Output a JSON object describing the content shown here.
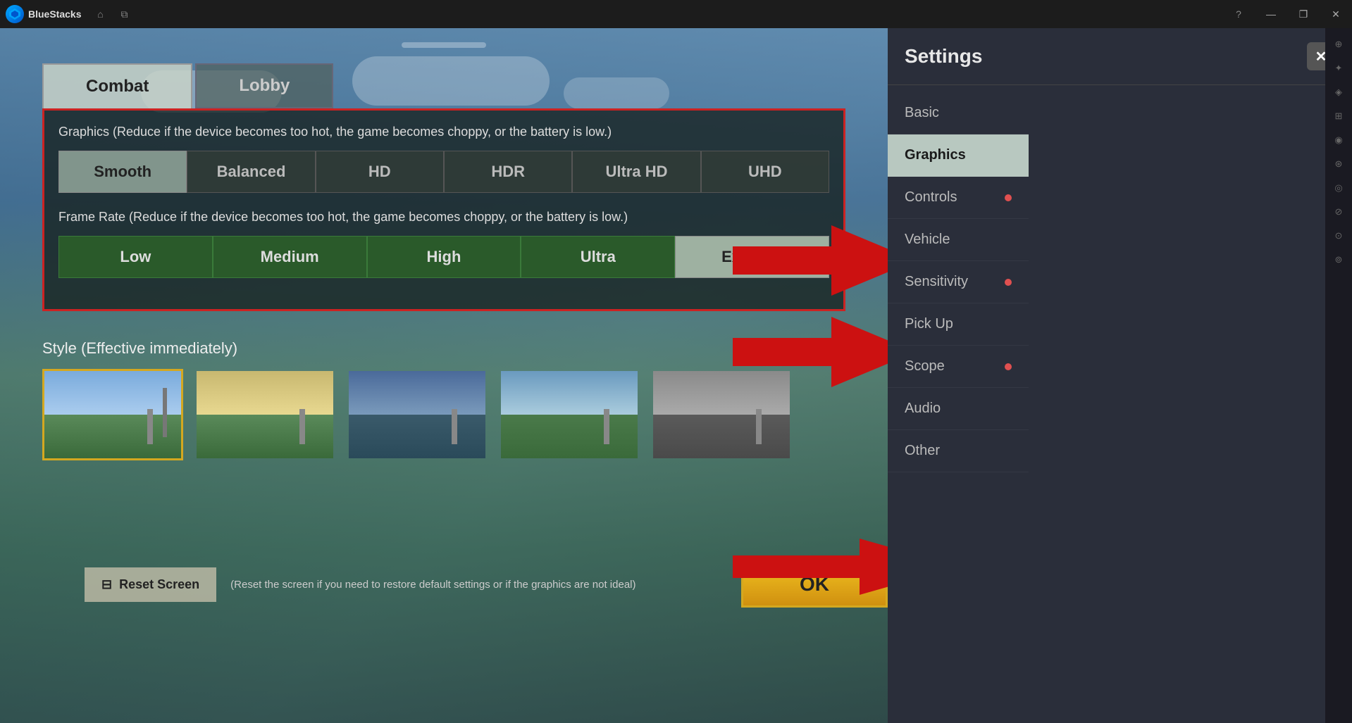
{
  "titlebar": {
    "app_name": "BlueStacks",
    "home_icon": "⌂",
    "multi_icon": "⧉",
    "help_icon": "?",
    "minimize": "—",
    "restore": "❐",
    "close": "✕"
  },
  "game": {
    "scroll_bar": true
  },
  "settings_panel": {
    "title": "Settings",
    "close_icon": "✕",
    "nav_items": [
      {
        "label": "Basic",
        "has_dot": false,
        "active": false
      },
      {
        "label": "Graphics",
        "has_dot": false,
        "active": true
      },
      {
        "label": "Controls",
        "has_dot": true,
        "active": false
      },
      {
        "label": "Vehicle",
        "has_dot": false,
        "active": false
      },
      {
        "label": "Sensitivity",
        "has_dot": true,
        "active": false
      },
      {
        "label": "Pick Up",
        "has_dot": false,
        "active": false
      },
      {
        "label": "Scope",
        "has_dot": true,
        "active": false
      },
      {
        "label": "Audio",
        "has_dot": false,
        "active": false
      },
      {
        "label": "Other",
        "has_dot": false,
        "active": false
      }
    ]
  },
  "tabs": [
    {
      "label": "Combat",
      "active": true
    },
    {
      "label": "Lobby",
      "active": false
    }
  ],
  "graphics_section": {
    "label": "Graphics (Reduce if the device becomes too hot, the game becomes choppy, or the battery is low.)",
    "options": [
      {
        "label": "Smooth",
        "selected": true
      },
      {
        "label": "Balanced",
        "selected": false
      },
      {
        "label": "HD",
        "selected": false
      },
      {
        "label": "HDR",
        "selected": false
      },
      {
        "label": "Ultra HD",
        "selected": false
      },
      {
        "label": "UHD",
        "selected": false
      }
    ]
  },
  "framerate_section": {
    "label": "Frame Rate (Reduce if the device becomes too hot, the game becomes choppy, or the battery is low.)",
    "options": [
      {
        "label": "Low",
        "selected": false
      },
      {
        "label": "Medium",
        "selected": false
      },
      {
        "label": "High",
        "selected": false
      },
      {
        "label": "Ultra",
        "selected": false
      },
      {
        "label": "Extreme",
        "selected": true
      }
    ]
  },
  "style_section": {
    "label": "Style (Effective immediately)",
    "thumbnails": [
      {
        "selected": true
      },
      {
        "selected": false
      },
      {
        "selected": false
      },
      {
        "selected": false
      },
      {
        "selected": false
      }
    ]
  },
  "bottom_bar": {
    "reset_icon": "⊟",
    "reset_label": "Reset Screen",
    "reset_note": "(Reset the screen if you need to restore default settings or if the graphics are not ideal)",
    "ok_label": "OK"
  },
  "sidebar_icons": [
    "⊕",
    "✦",
    "◈",
    "⊞",
    "◉",
    "⊛",
    "◎",
    "⊘",
    "⊙",
    "⊚"
  ]
}
